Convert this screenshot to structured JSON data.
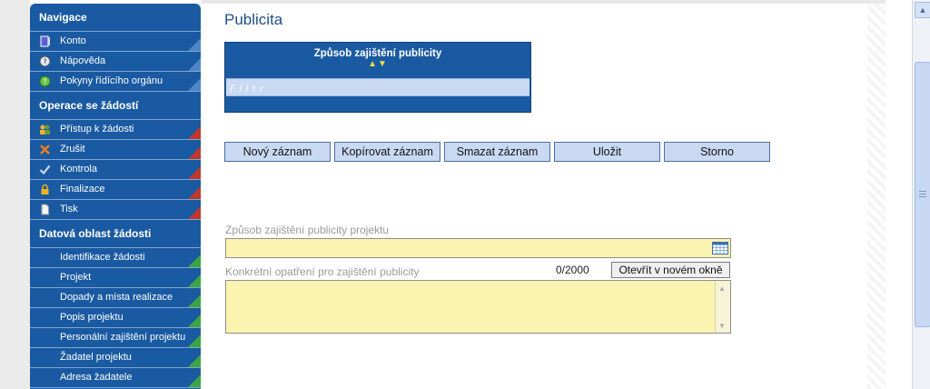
{
  "sidebar": {
    "sections": [
      {
        "title": "Navigace",
        "items": [
          {
            "label": "Konto",
            "icon": "account-book-icon"
          },
          {
            "label": "Nápověda",
            "icon": "help-icon"
          },
          {
            "label": "Pokyny řídícího orgánu",
            "icon": "guidelines-icon"
          }
        ]
      },
      {
        "title": "Operace se žádostí",
        "items": [
          {
            "label": "Přístup k žádosti",
            "icon": "users-icon"
          },
          {
            "label": "Zrušit",
            "icon": "cancel-icon"
          },
          {
            "label": "Kontrola",
            "icon": "checkmark-icon"
          },
          {
            "label": "Finalizace",
            "icon": "lock-icon"
          },
          {
            "label": "Tisk",
            "icon": "document-icon"
          }
        ]
      },
      {
        "title": "Datová oblast žádosti",
        "items": [
          {
            "label": "Identifikace žádosti"
          },
          {
            "label": "Projekt"
          },
          {
            "label": "Dopady a místa realizace"
          },
          {
            "label": "Popis projektu"
          },
          {
            "label": "Personální zajištění projektu"
          },
          {
            "label": "Žadatel projektu"
          },
          {
            "label": "Adresa žadatele"
          }
        ]
      }
    ]
  },
  "main": {
    "title": "Publicita",
    "table": {
      "column_header": "Způsob zajištění publicity",
      "sort_indicator": "▲▼",
      "filter_placeholder": "Filtr"
    },
    "buttons": {
      "new": "Nový záznam",
      "copy": "Kopírovat záznam",
      "delete": "Smazat záznam",
      "save": "Uložit",
      "cancel": "Storno"
    },
    "form": {
      "field1_label": "Způsob zajištění publicity projektu",
      "field1_value": "",
      "field2_label": "Konkrétní opatření pro zajištění publicity",
      "field2_counter": "0/2000",
      "field2_open_button": "Otevřít v novém okně",
      "field2_value": ""
    }
  },
  "colors": {
    "sidebar_bg": "#1a5aa2",
    "button_bg": "#c9d9f2",
    "field_bg": "#fbf3b0",
    "title_color": "#1f4f86",
    "sort_arrow": "#e8e04a"
  }
}
